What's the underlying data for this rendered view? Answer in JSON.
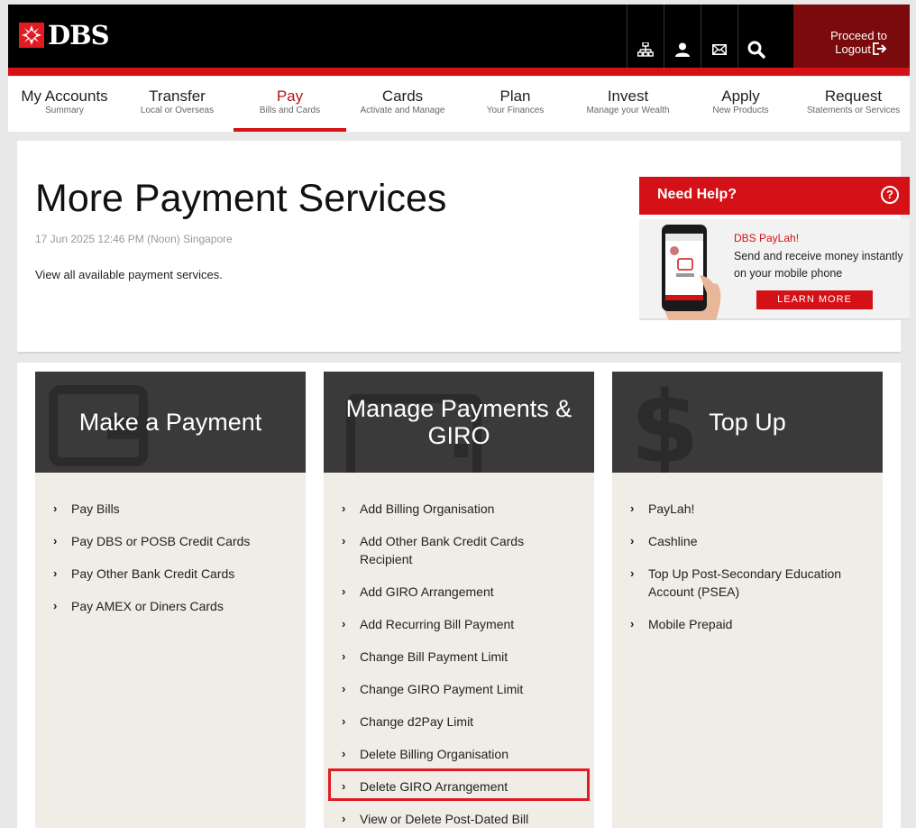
{
  "header": {
    "logo_text": "DBS",
    "icons": [
      "sitemap-icon",
      "user-icon",
      "mail-icon",
      "search-icon"
    ],
    "logout_line1": "Proceed to",
    "logout_line2": "Logout"
  },
  "nav": [
    {
      "label": "My Accounts",
      "sub": "Summary"
    },
    {
      "label": "Transfer",
      "sub": "Local or Overseas"
    },
    {
      "label": "Pay",
      "sub": "Bills and Cards",
      "active": true
    },
    {
      "label": "Cards",
      "sub": "Activate and Manage"
    },
    {
      "label": "Plan",
      "sub": "Your Finances"
    },
    {
      "label": "Invest",
      "sub": "Manage your Wealth"
    },
    {
      "label": "Apply",
      "sub": "New Products"
    },
    {
      "label": "Request",
      "sub": "Statements or Services"
    }
  ],
  "page": {
    "title": "More Payment Services",
    "timestamp": "17 Jun 2025 12:46 PM (Noon) Singapore",
    "description": "View all available payment services."
  },
  "help": {
    "heading": "Need Help?",
    "icon": "?",
    "promo_title": "DBS PayLah!",
    "promo_text": "Send and receive money instantly on your mobile phone",
    "button": "LEARN MORE"
  },
  "cards": [
    {
      "title": "Make a Payment",
      "items": [
        "Pay Bills",
        "Pay DBS or POSB Credit Cards",
        "Pay Other Bank Credit Cards",
        "Pay AMEX or Diners Cards"
      ]
    },
    {
      "title": "Manage Payments & GIRO",
      "items": [
        "Add Billing Organisation",
        "Add Other Bank Credit Cards Recipient",
        "Add GIRO Arrangement",
        "Add Recurring Bill Payment",
        "Change Bill Payment Limit",
        "Change GIRO Payment Limit",
        "Change d2Pay Limit",
        "Delete Billing Organisation",
        "Delete GIRO Arrangement",
        "View or Delete Post-Dated Bill"
      ]
    },
    {
      "title": "Top Up",
      "items": [
        "PayLah!",
        "Cashline",
        "Top Up Post-Secondary Education Account (PSEA)",
        "Mobile Prepaid"
      ]
    }
  ],
  "colors": {
    "brand_red": "#d41117",
    "header_black": "#000000",
    "card_head": "#3a3a3a",
    "card_body": "#f0ece6"
  }
}
